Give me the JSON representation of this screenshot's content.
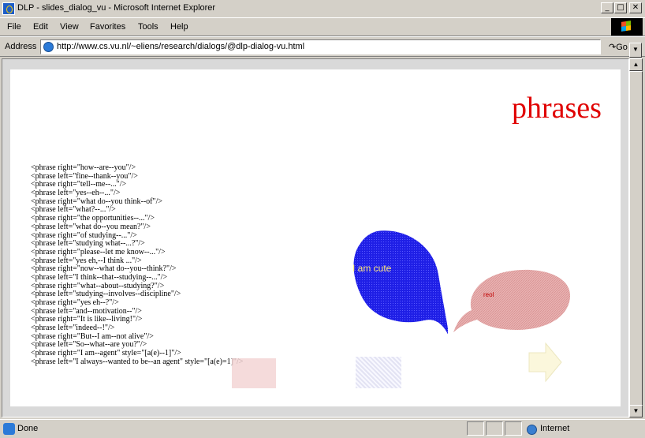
{
  "window": {
    "title": "DLP - slides_dialog_vu - Microsoft Internet Explorer",
    "controls": {
      "minimize": "_",
      "maximize": "□",
      "close": "✕"
    }
  },
  "menu": [
    "File",
    "Edit",
    "View",
    "Favorites",
    "Tools",
    "Help"
  ],
  "address": {
    "label": "Address",
    "url": "http://www.cs.vu.nl/~eliens/research/dialogs/@dlp-dialog-vu.html",
    "go_label": "Go",
    "go_arrow": "↷"
  },
  "page": {
    "heading": "phrases",
    "code_lines": [
      "<phrase right=\"how--are--you\"/>",
      "<phrase left=\"fine--thank--you\"/>",
      "<phrase right=\"tell--me--...\"/>",
      "<phrase left=\"yes--eh--...\"/>",
      "<phrase right=\"what do--you think--of\"/>",
      "<phrase left=\"what?--...\"/>",
      "<phrase right=\"the opportunities--...\"/>",
      "<phrase left=\"what do--you mean?\"/>",
      "<phrase right=\"of studying--...\"/>",
      "<phrase left=\"studying what--...?\"/>",
      "<phrase right=\"please--let me know--...\"/>",
      "<phrase left=\"yes eh,--I think ...\"/>",
      "<phrase right=\"now--what do--you--think?\"/>",
      "<phrase left=\"I think--that--studying--...\"/>",
      "<phrase right=\"what--about--studying?\"/>",
      "<phrase left=\"studying--involves--discipline\"/>",
      "<phrase right=\"yes eh--?\"/>",
      "<phrase left=\"and--motivation--\"/>",
      "<phrase right=\"It is like--living!\"/>",
      "<phrase left=\"indeed--!\"/>",
      "<phrase right=\"But--I am--not alive\"/>",
      "<phrase left=\"So--what--are you?\"/>",
      "<phrase right=\"I am--agent\" style=\"[a(e)--1]\"/>",
      "<phrase left=\"I always--wanted to be--an agent\" style=\"[a(e)=1]\"/>"
    ],
    "bubble_text": "I am cute",
    "reply_text": "reol",
    "colors": {
      "heading": "#e00000",
      "bubble": "#1f1fe6",
      "reply_bubble": "#e7a3a3"
    }
  },
  "status": {
    "text": "Done",
    "zone": "Internet"
  }
}
